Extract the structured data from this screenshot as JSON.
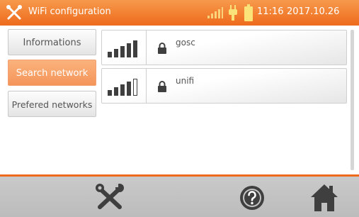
{
  "header": {
    "title": "WiFi configuration",
    "time": "11:16",
    "date": "2017.10.26",
    "icons": [
      "tools-icon",
      "signal-icon",
      "plug-icon",
      "battery-icon"
    ]
  },
  "sidebar": {
    "items": [
      {
        "label": "Informations",
        "active": false
      },
      {
        "label": "Search network",
        "active": true
      },
      {
        "label": "Prefered networks",
        "active": false
      }
    ]
  },
  "networks": [
    {
      "ssid": "gosc",
      "signal_bars": 5,
      "secured": true
    },
    {
      "ssid": "unifi",
      "signal_bars": 4,
      "secured": true
    }
  ],
  "footer": {
    "icons": [
      "tools-icon",
      "help-icon",
      "home-icon"
    ]
  },
  "colors": {
    "accent": "#ee6a1c",
    "active_button": "#f4955a",
    "footer_bg": "#c4c4c4",
    "icon_dark": "#3f3f3f"
  }
}
